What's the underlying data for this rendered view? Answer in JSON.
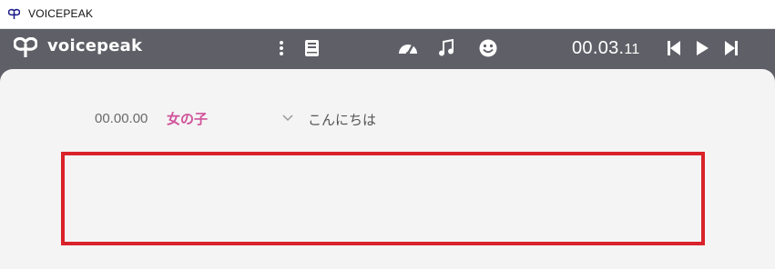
{
  "window": {
    "title": "VOICEPEAK",
    "icon": "voicepeak-logo-icon"
  },
  "toolbar": {
    "logo_text": "voicepeak",
    "icons": [
      "more-vert-icon",
      "book-icon",
      "speed-gauge-icon",
      "music-note-icon",
      "emotion-face-icon",
      "skip-back-icon",
      "play-icon",
      "skip-forward-icon"
    ],
    "timecode_main": "00.03.",
    "timecode_frac": "11"
  },
  "editor": {
    "rows": [
      {
        "time": "00.00.00",
        "voice": "女の子",
        "text": "こんにちは"
      }
    ]
  },
  "colors": {
    "toolbar_bg": "#5f5f67",
    "panel_bg": "#f4f4f4",
    "voice_accent": "#d0539a",
    "highlight_border": "#d9222a"
  }
}
